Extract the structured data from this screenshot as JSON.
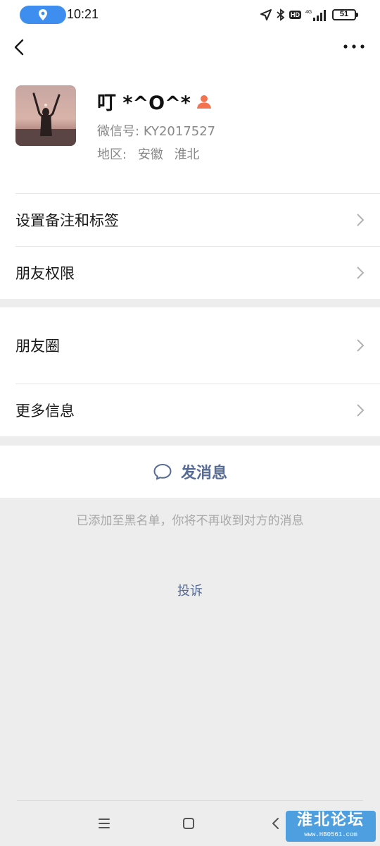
{
  "status_bar": {
    "time": "10:21",
    "network_type": "4G",
    "hd_badge": "HD",
    "battery_level": "51"
  },
  "profile": {
    "name": "叮 *^O^*",
    "wechat_id_label": "微信号:",
    "wechat_id": "KY2017527",
    "region_label": "地区:",
    "region_province": "安徽",
    "region_city": "淮北"
  },
  "menu": {
    "set_remark_tags": "设置备注和标签",
    "friend_permissions": "朋友权限",
    "moments": "朋友圈",
    "more_info": "更多信息"
  },
  "actions": {
    "send_message": "发消息",
    "blacklist_notice": "已添加至黑名单，你将不再收到对方的消息",
    "complain": "投诉"
  },
  "watermark": {
    "title": "淮北论坛",
    "url": "www.HB0561.com"
  },
  "colors": {
    "link": "#576b95",
    "background": "#ededed",
    "location_pill": "#3d8eef",
    "person_icon": "#f2734f"
  },
  "icons": [
    "location-icon",
    "navigation-arrow-icon",
    "bluetooth-icon",
    "signal-icon",
    "battery-icon",
    "back-icon",
    "more-icon",
    "person-icon",
    "chevron-right-icon",
    "chat-bubble-icon",
    "menu-icon",
    "home-icon",
    "back-triangle-icon"
  ]
}
